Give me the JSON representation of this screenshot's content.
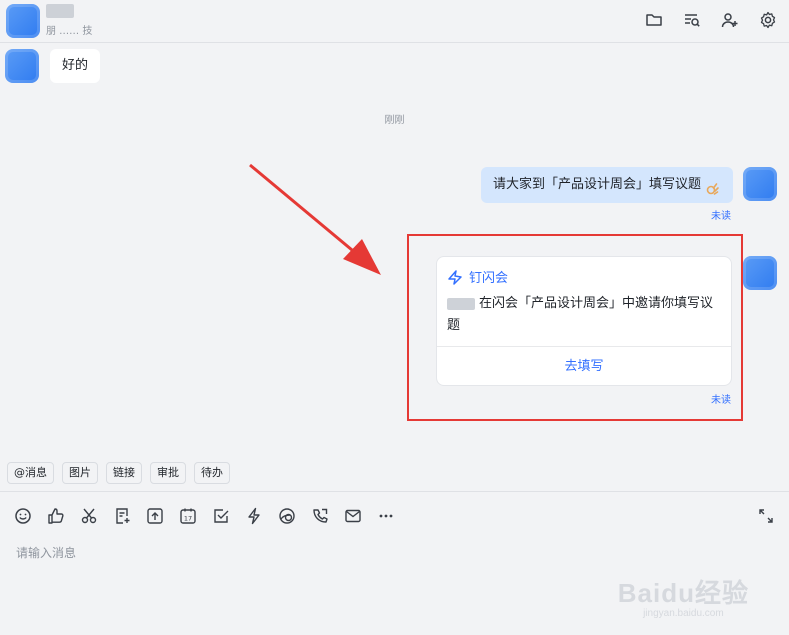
{
  "header": {
    "subtitle": "朋 …… 技",
    "icons": [
      "folder-icon",
      "search-list-icon",
      "add-member-icon",
      "gear-icon"
    ]
  },
  "messages": {
    "incoming_text": "好的",
    "timestamp": "刚刚",
    "outgoing_text": "请大家到「产品设计周会」填写议题",
    "outgoing_unread": "未读"
  },
  "card": {
    "app_name": "钉闪会",
    "body": "在闪会「产品设计周会」中邀请你填写议题",
    "action": "去填写",
    "unread": "未读"
  },
  "quick_actions": [
    "@消息",
    "图片",
    "链接",
    "审批",
    "待办"
  ],
  "toolbar_icons": [
    "emoji-icon",
    "thumbs-up-icon",
    "scissors-icon",
    "doc-add-icon",
    "upload-icon",
    "calendar-icon",
    "checkbox-icon",
    "lightning-icon",
    "sticker-icon",
    "phone-icon",
    "mail-icon",
    "more-icon",
    "expand-icon"
  ],
  "calendar_day": "17",
  "input": {
    "placeholder": "请输入消息"
  },
  "watermark": {
    "main": "Baidu经验",
    "sub": "jingyan.baidu.com"
  },
  "colors": {
    "accent": "#3370ff",
    "outgoing_bubble": "#d4e6fd",
    "highlight": "#e53935"
  }
}
